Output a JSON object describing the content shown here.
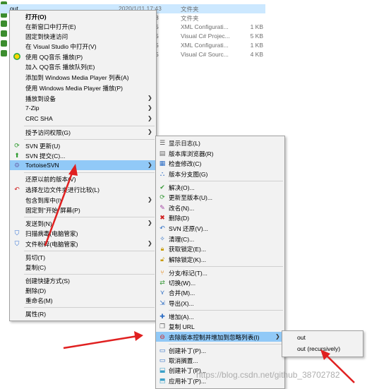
{
  "explorer": {
    "rows": [
      {
        "name": "out",
        "date": "2020/1/11 17:43",
        "type": "文件夹",
        "size": "",
        "selected": true
      },
      {
        "name": "",
        "date": "8",
        "type": "文件夹",
        "size": ""
      },
      {
        "name": "",
        "date": "5",
        "type": "XML Configurati...",
        "size": "1 KB"
      },
      {
        "name": "",
        "date": "5",
        "type": "Visual C# Projec...",
        "size": "5 KB"
      },
      {
        "name": "",
        "date": "5",
        "type": "XML Configurati...",
        "size": "1 KB"
      },
      {
        "name": "",
        "date": "5",
        "type": "Visual C# Sourc...",
        "size": "4 KB"
      }
    ]
  },
  "main_menu": {
    "items": [
      {
        "label": "打开(O)",
        "bold": true
      },
      {
        "label": "在新窗口中打开(E)"
      },
      {
        "label": "固定到快速访问"
      },
      {
        "label": "在 Visual Studio 中打开(V)"
      },
      {
        "label": "使用 QQ音乐 播放(P)",
        "icon": "qq-music-icon"
      },
      {
        "label": "加入 QQ音乐 播放队列(E)"
      },
      {
        "label": "添加到 Windows Media Player 列表(A)"
      },
      {
        "label": "使用 Windows Media Player 播放(P)"
      },
      {
        "label": "播放到设备",
        "submenu": true
      },
      {
        "label": "7-Zip",
        "submenu": true
      },
      {
        "label": "CRC SHA",
        "submenu": true
      },
      {
        "label": "授予访问权限(G)",
        "submenu": true
      },
      {
        "label": "SVN 更新(U)",
        "icon": "svn-update-icon"
      },
      {
        "label": "SVN 提交(C)...",
        "icon": "svn-commit-icon"
      },
      {
        "label": "TortoiseSVN",
        "icon": "tortoisesvn-icon",
        "submenu": true,
        "hover": true
      },
      {
        "label": "还原以前的版本(V)"
      },
      {
        "label": "选择左边文件夹进行比较(L)",
        "icon": "compare-icon"
      },
      {
        "label": "包含到库中(I)",
        "submenu": true
      },
      {
        "label": "固定到\"开始\"屏幕(P)"
      },
      {
        "label": "发送到(N)",
        "submenu": true
      },
      {
        "label": "扫描病毒(电脑管家)",
        "icon": "shield-icon"
      },
      {
        "label": "文件粉碎(电脑管家)",
        "icon": "shield-icon",
        "submenu": true
      },
      {
        "label": "剪切(T)"
      },
      {
        "label": "复制(C)"
      },
      {
        "label": "创建快捷方式(S)"
      },
      {
        "label": "删除(D)"
      },
      {
        "label": "重命名(M)"
      },
      {
        "label": "属性(R)"
      }
    ]
  },
  "svn_menu": {
    "items": [
      {
        "label": "显示日志(L)",
        "icon": "log-icon"
      },
      {
        "label": "版本库浏览器(R)",
        "icon": "repo-browser-icon"
      },
      {
        "label": "检查修改(C)",
        "icon": "check-modifications-icon"
      },
      {
        "label": "版本分支图(G)",
        "icon": "revision-graph-icon"
      },
      {
        "label": "解决(O)...",
        "icon": "resolve-icon"
      },
      {
        "label": "更新至版本(U)...",
        "icon": "update-revision-icon"
      },
      {
        "label": "改名(N)...",
        "icon": "rename-icon"
      },
      {
        "label": "删除(D)",
        "icon": "delete-icon"
      },
      {
        "label": "SVN 还原(V)...",
        "icon": "revert-icon"
      },
      {
        "label": "清理(C)...",
        "icon": "cleanup-icon"
      },
      {
        "label": "获取锁定(E)...",
        "icon": "lock-icon"
      },
      {
        "label": "解除锁定(K)...",
        "icon": "unlock-icon"
      },
      {
        "label": "分支/标记(T)...",
        "icon": "branch-icon"
      },
      {
        "label": "切换(W)...",
        "icon": "switch-icon"
      },
      {
        "label": "合并(M)...",
        "icon": "merge-icon"
      },
      {
        "label": "导出(X)...",
        "icon": "export-icon"
      },
      {
        "label": "增加(A)...",
        "icon": "add-icon"
      },
      {
        "label": "复制 URL",
        "icon": "copy-url-icon"
      },
      {
        "label": "去除版本控制并增加到忽略列表(I)",
        "icon": "ignore-icon",
        "submenu": true,
        "hover": true
      },
      {
        "label": "创建补丁(P)...",
        "icon": "create-patch-icon"
      },
      {
        "label": "取消搁置...",
        "icon": "unshelve-icon"
      },
      {
        "label": "创建补丁(P)...",
        "icon": "create-patch-icon"
      },
      {
        "label": "应用补丁(P)...",
        "icon": "apply-patch-icon"
      }
    ]
  },
  "ignore_menu": {
    "items": [
      {
        "label": "out"
      },
      {
        "label": "out (recursively)"
      }
    ]
  },
  "watermark": "https://blog.csdn.net/github_38702782"
}
